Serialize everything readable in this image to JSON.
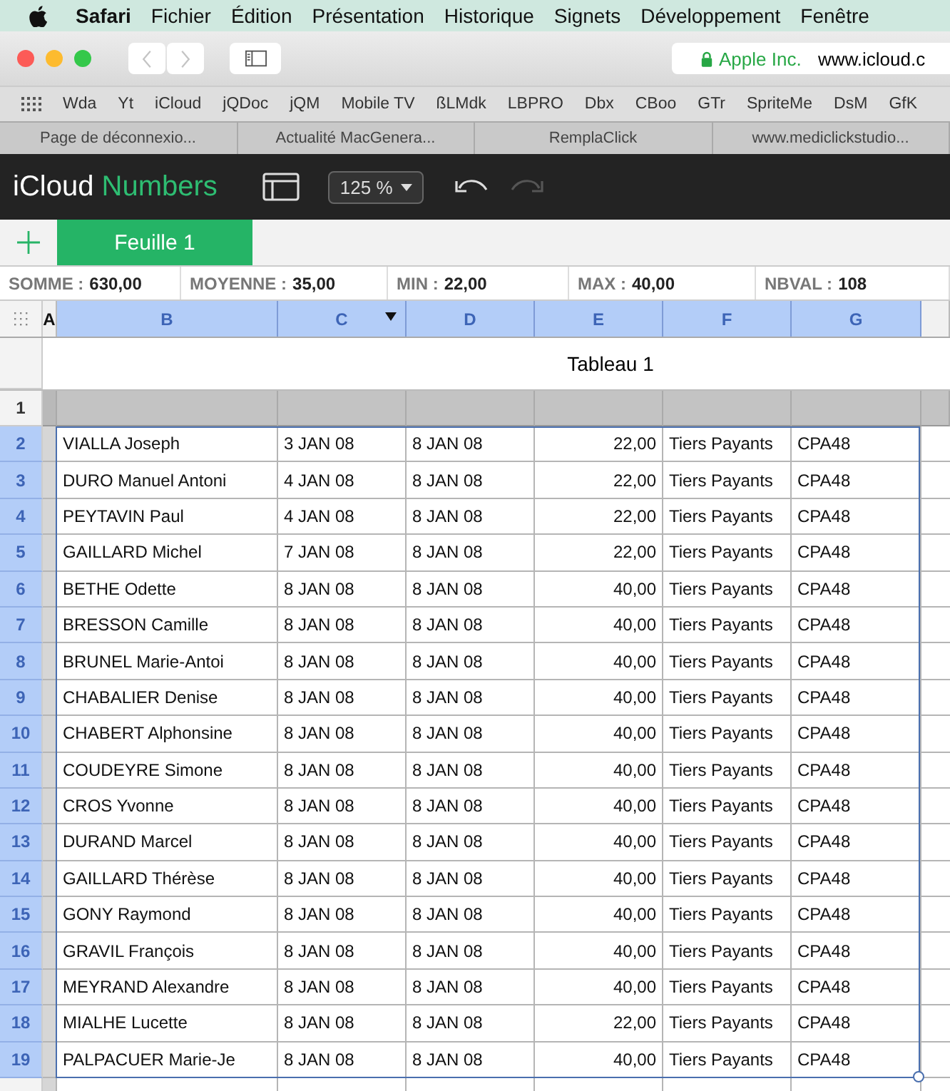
{
  "menu_bar": {
    "app": "Safari",
    "items": [
      "Fichier",
      "Édition",
      "Présentation",
      "Historique",
      "Signets",
      "Développement",
      "Fenêtre"
    ]
  },
  "toolbar": {
    "address": {
      "owner": "Apple Inc.",
      "url": "www.icloud.c"
    }
  },
  "bookmarks": [
    "Wda",
    "Yt",
    "iCloud",
    "jQDoc",
    "jQM",
    "Mobile TV",
    "ßLMdk",
    "LBPRO",
    "Dbx",
    "CBoo",
    "GTr",
    "SpriteMe",
    "DsM",
    "GfK"
  ],
  "tabs": [
    "Page de déconnexio...",
    "Actualité MacGenera...",
    "RemplaClick",
    "www.mediclickstudio..."
  ],
  "app_bar": {
    "brand": "iCloud",
    "product": "Numbers",
    "zoom": "125 %",
    "redo_enabled": false
  },
  "sheets": [
    {
      "label": "Feuille 1",
      "selected": true
    }
  ],
  "stats": [
    {
      "label": "SOMME :",
      "value": "630,00"
    },
    {
      "label": "MOYENNE :",
      "value": "35,00"
    },
    {
      "label": "MIN :",
      "value": "22,00"
    },
    {
      "label": "MAX :",
      "value": "40,00"
    },
    {
      "label": "NBVAL :",
      "value": "108"
    }
  ],
  "table": {
    "title": "Tableau 1",
    "columns": [
      {
        "label": "A",
        "selected": false,
        "menu": false
      },
      {
        "label": "B",
        "selected": true,
        "menu": false
      },
      {
        "label": "C",
        "selected": true,
        "menu": true
      },
      {
        "label": "D",
        "selected": true,
        "menu": false
      },
      {
        "label": "E",
        "selected": true,
        "menu": false
      },
      {
        "label": "F",
        "selected": true,
        "menu": false
      },
      {
        "label": "G",
        "selected": true,
        "menu": false
      }
    ],
    "header_row": "1",
    "rows": [
      {
        "number": "2",
        "selected": true,
        "cells": [
          "",
          "VIALLA Joseph",
          "3 JAN  08",
          "8 JAN  08",
          "22,00",
          "Tiers Payants",
          "CPA48"
        ]
      },
      {
        "number": "3",
        "selected": true,
        "cells": [
          "",
          "DURO Manuel Antoni",
          "4 JAN  08",
          "8 JAN  08",
          "22,00",
          "Tiers Payants",
          "CPA48"
        ]
      },
      {
        "number": "4",
        "selected": true,
        "cells": [
          "",
          "PEYTAVIN Paul",
          "4 JAN  08",
          "8 JAN  08",
          "22,00",
          "Tiers Payants",
          "CPA48"
        ]
      },
      {
        "number": "5",
        "selected": true,
        "cells": [
          "",
          "GAILLARD Michel",
          "7 JAN  08",
          "8 JAN  08",
          "22,00",
          "Tiers Payants",
          "CPA48"
        ]
      },
      {
        "number": "6",
        "selected": true,
        "cells": [
          "",
          "BETHE Odette",
          "8 JAN  08",
          "8 JAN  08",
          "40,00",
          "Tiers Payants",
          "CPA48"
        ]
      },
      {
        "number": "7",
        "selected": true,
        "cells": [
          "",
          "BRESSON Camille",
          "8 JAN  08",
          "8 JAN  08",
          "40,00",
          "Tiers Payants",
          "CPA48"
        ]
      },
      {
        "number": "8",
        "selected": true,
        "cells": [
          "",
          "BRUNEL Marie-Antoi",
          "8 JAN  08",
          "8 JAN  08",
          "40,00",
          "Tiers Payants",
          "CPA48"
        ]
      },
      {
        "number": "9",
        "selected": true,
        "cells": [
          "",
          "CHABALIER Denise",
          "8 JAN  08",
          "8 JAN  08",
          "40,00",
          "Tiers Payants",
          "CPA48"
        ]
      },
      {
        "number": "10",
        "selected": true,
        "cells": [
          "",
          "CHABERT Alphonsine",
          "8 JAN  08",
          "8 JAN  08",
          "40,00",
          "Tiers Payants",
          "CPA48"
        ]
      },
      {
        "number": "11",
        "selected": true,
        "cells": [
          "",
          "COUDEYRE Simone",
          "8 JAN  08",
          "8 JAN  08",
          "40,00",
          "Tiers Payants",
          "CPA48"
        ]
      },
      {
        "number": "12",
        "selected": true,
        "cells": [
          "",
          "CROS Yvonne",
          "8 JAN  08",
          "8 JAN  08",
          "40,00",
          "Tiers Payants",
          "CPA48"
        ]
      },
      {
        "number": "13",
        "selected": true,
        "cells": [
          "",
          "DURAND Marcel",
          "8 JAN  08",
          "8 JAN  08",
          "40,00",
          "Tiers Payants",
          "CPA48"
        ]
      },
      {
        "number": "14",
        "selected": true,
        "cells": [
          "",
          "GAILLARD Thérèse",
          "8 JAN  08",
          "8 JAN  08",
          "40,00",
          "Tiers Payants",
          "CPA48"
        ]
      },
      {
        "number": "15",
        "selected": true,
        "cells": [
          "",
          "GONY Raymond",
          "8 JAN  08",
          "8 JAN  08",
          "40,00",
          "Tiers Payants",
          "CPA48"
        ]
      },
      {
        "number": "16",
        "selected": true,
        "cells": [
          "",
          "GRAVIL François",
          "8 JAN  08",
          "8 JAN  08",
          "40,00",
          "Tiers Payants",
          "CPA48"
        ]
      },
      {
        "number": "17",
        "selected": true,
        "cells": [
          "",
          "MEYRAND Alexandre",
          "8 JAN  08",
          "8 JAN  08",
          "40,00",
          "Tiers Payants",
          "CPA48"
        ]
      },
      {
        "number": "18",
        "selected": true,
        "cells": [
          "",
          "MIALHE Lucette",
          "8 JAN  08",
          "8 JAN  08",
          "22,00",
          "Tiers Payants",
          "CPA48"
        ]
      },
      {
        "number": "19",
        "selected": true,
        "cells": [
          "",
          "PALPACUER Marie-Je",
          "8 JAN  08",
          "8 JAN  08",
          "40,00",
          "Tiers Payants",
          "CPA48"
        ]
      }
    ]
  }
}
